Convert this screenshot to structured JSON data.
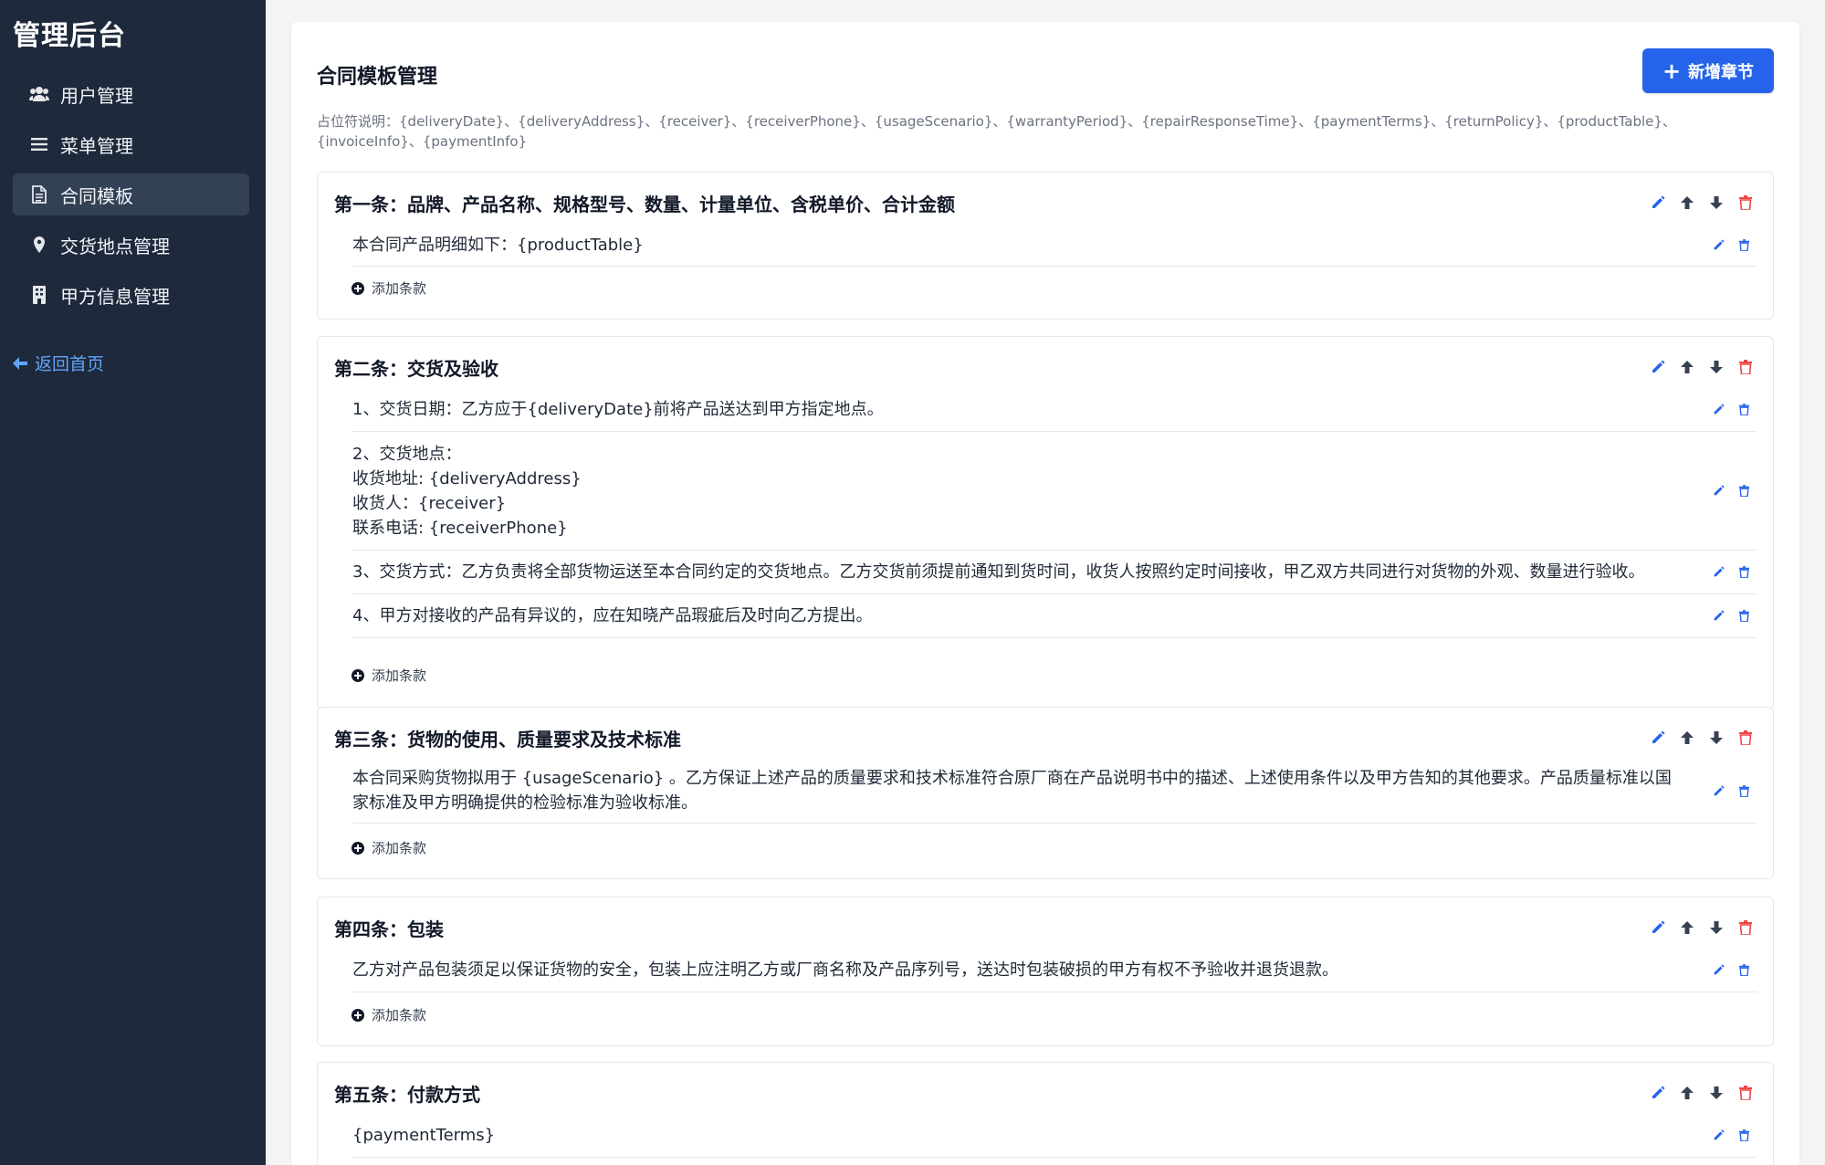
{
  "sidebar": {
    "brand": "管理后台",
    "items": [
      {
        "label": "用户管理",
        "icon": "users-icon"
      },
      {
        "label": "菜单管理",
        "icon": "list-icon"
      },
      {
        "label": "合同模板",
        "icon": "document-icon",
        "active": true
      },
      {
        "label": "交货地点管理",
        "icon": "map-pin-icon"
      },
      {
        "label": "甲方信息管理",
        "icon": "building-icon"
      }
    ],
    "back_label": "返回首页"
  },
  "main": {
    "title": "合同模板管理",
    "add_section_label": "新增章节",
    "placeholder_note": "占位符说明：{deliveryDate}、{deliveryAddress}、{receiver}、{receiverPhone}、{usageScenario}、{warrantyPeriod}、{repairResponseTime}、{paymentTerms}、{returnPolicy}、{productTable}、{invoiceInfo}、{paymentInfo}",
    "add_clause_label": "添加条款",
    "sections": [
      {
        "title": "第一条：品牌、产品名称、规格型号、数量、计量单位、含税单价、合计金额",
        "clauses": [
          "本合同产品明细如下：{productTable}"
        ]
      },
      {
        "title": "第二条：交货及验收",
        "clauses": [
          "1、交货日期：乙方应于{deliveryDate}前将产品送达到甲方指定地点。",
          "2、交货地点：\n收货地址: {deliveryAddress}\n收货人：{receiver}\n联系电话: {receiverPhone}",
          "3、交货方式：乙方负责将全部货物运送至本合同约定的交货地点。乙方交货前须提前通知到货时间，收货人按照约定时间接收，甲乙双方共同进行对货物的外观、数量进行验收。",
          "4、甲方对接收的产品有异议的，应在知晓产品瑕疵后及时向乙方提出。"
        ]
      },
      {
        "title": "第三条：货物的使用、质量要求及技术标准",
        "clauses": [
          "本合同采购货物拟用于 {usageScenario} 。乙方保证上述产品的质量要求和技术标准符合原厂商在产品说明书中的描述、上述使用条件以及甲方告知的其他要求。产品质量标准以国家标准及甲方明确提供的检验标准为验收标准。"
        ]
      },
      {
        "title": "第四条：包装",
        "clauses": [
          "乙方对产品包装须足以保证货物的安全，包装上应注明乙方或厂商名称及产品序列号，送达时包装破损的甲方有权不予验收并退货退款。"
        ]
      },
      {
        "title": "第五条：付款方式",
        "clauses": [
          "{paymentTerms}"
        ]
      }
    ]
  },
  "colors": {
    "sidebar_bg": "#1e293b",
    "accent": "#2563eb",
    "link": "#60a5fa",
    "danger": "#ef4444"
  }
}
